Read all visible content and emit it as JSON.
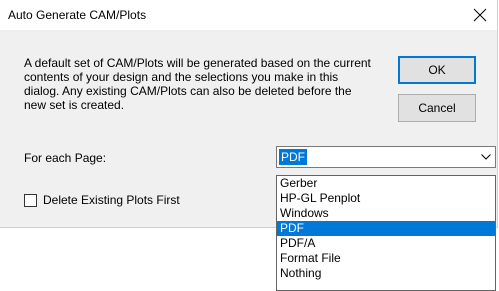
{
  "window": {
    "title": "Auto Generate CAM/Plots"
  },
  "description": "A default set of CAM/Plots will be generated based on the current contents of your design and the selections you make in this dialog. Any existing CAM/Plots can also be deleted before the new set is created.",
  "buttons": {
    "ok_label": "OK",
    "cancel_label": "Cancel"
  },
  "page_select": {
    "label": "For each Page:",
    "value": "PDF",
    "options": [
      "Gerber",
      "HP-GL Penplot",
      "Windows",
      "PDF",
      "PDF/A",
      "Format File",
      "Nothing"
    ],
    "selected_option": "PDF"
  },
  "delete_plots": {
    "label": "Delete Existing Plots First",
    "checked": false
  },
  "colors": {
    "accent": "#0078d7",
    "dialog_bg": "#f0f0f0",
    "button_bg": "#e1e1e1"
  }
}
